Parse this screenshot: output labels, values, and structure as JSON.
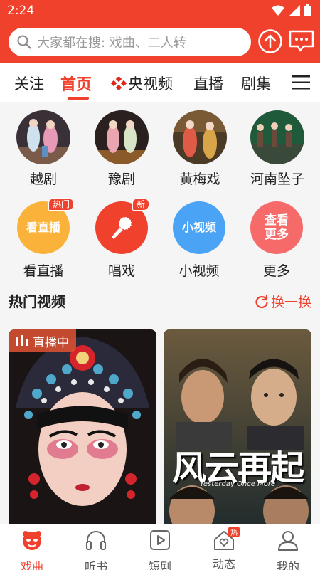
{
  "status": {
    "time": "2:24"
  },
  "search": {
    "placeholder": "大家都在搜: 戏曲、二人转"
  },
  "tabs": [
    {
      "label": "关注"
    },
    {
      "label": "首页"
    },
    {
      "label": "央视频"
    },
    {
      "label": "直播"
    },
    {
      "label": "剧集"
    }
  ],
  "categories": [
    {
      "label": "越剧"
    },
    {
      "label": "豫剧"
    },
    {
      "label": "黄梅戏"
    },
    {
      "label": "河南坠子"
    }
  ],
  "functions": [
    {
      "icon_text": "看直播",
      "label": "看直播",
      "badge": "热门",
      "color": "#fbb23a"
    },
    {
      "icon_text": "",
      "label": "唱戏",
      "badge": "新",
      "color": "#f0412d"
    },
    {
      "icon_text": "小视频",
      "label": "小视频",
      "badge": "",
      "color": "#4aa3f5"
    },
    {
      "icon_text": "查看\n更多",
      "label": "更多",
      "badge": "",
      "color": "#f76a6a"
    }
  ],
  "section": {
    "title": "热门视频",
    "refresh_label": "换一换"
  },
  "cards": [
    {
      "tag": "直播中"
    },
    {
      "title": "风云再起",
      "subtitle": "Yesterday Once More"
    }
  ],
  "bottom_nav": [
    {
      "label": "戏曲"
    },
    {
      "label": "听书"
    },
    {
      "label": "短剧"
    },
    {
      "label": "动态",
      "badge": "热"
    },
    {
      "label": "我的"
    }
  ],
  "colors": {
    "accent": "#f0412d"
  }
}
